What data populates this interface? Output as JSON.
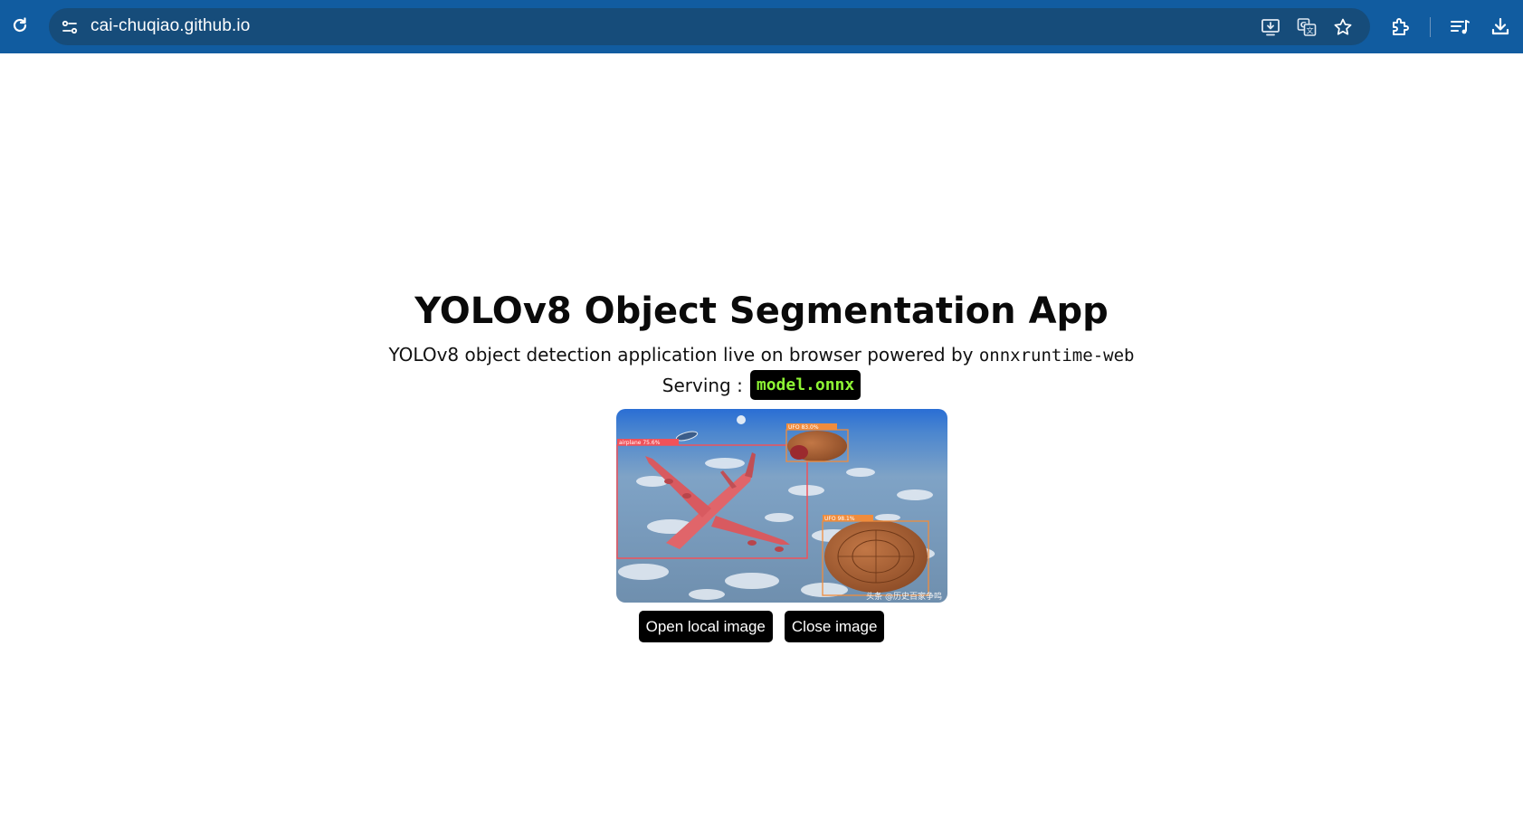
{
  "browser": {
    "url": "cai-chuqiao.github.io",
    "icons": [
      "reload-icon",
      "site-info-icon",
      "install-app-icon",
      "translate-icon",
      "bookmark-star-icon",
      "extensions-icon",
      "reading-list-icon",
      "download-icon"
    ]
  },
  "page": {
    "title": "YOLOv8 Object Segmentation App",
    "subtitle_prefix": "YOLOv8 object detection application live on browser powered by",
    "subtitle_code": "onnxruntime-web",
    "serving_label": "Serving :",
    "model_name": "model.onnx"
  },
  "result_image": {
    "detections": [
      {
        "label": "airplane 75.6%",
        "color": "#f0525a"
      },
      {
        "label": "UFO 83.0%",
        "color": "#f08c3c"
      },
      {
        "label": "UFO 98.1%",
        "color": "#f08c3c"
      }
    ],
    "watermark": "头条 @历史百家争鸣"
  },
  "buttons": {
    "open_label": "Open local image",
    "close_label": "Close image"
  },
  "colors": {
    "chrome_bg": "#115ca0",
    "omnibox_bg": "#164c7a",
    "badge_text": "#8ef534"
  }
}
